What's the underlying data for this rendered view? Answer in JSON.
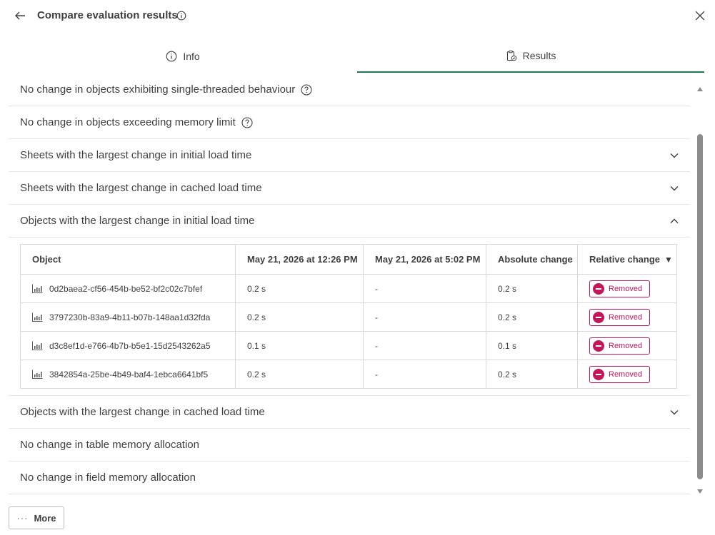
{
  "header": {
    "title": "Compare evaluation results"
  },
  "tabs": [
    {
      "label": "Info",
      "active": false
    },
    {
      "label": "Results",
      "active": true
    }
  ],
  "sections_top": [
    {
      "label": "No change in objects exhibiting single-threaded behaviour",
      "help": true
    },
    {
      "label": "No change in objects exceeding memory limit",
      "help": true
    },
    {
      "label": "Sheets with the largest change in initial load time",
      "expandable": true,
      "expanded": false
    },
    {
      "label": "Sheets with the largest change in cached load time",
      "expandable": true,
      "expanded": false
    },
    {
      "label": "Objects with the largest change in initial load time",
      "expandable": true,
      "expanded": true
    }
  ],
  "table": {
    "columns": [
      "Object",
      "May 21, 2026 at 12:26 PM",
      "May 21, 2026 at 5:02 PM",
      "Absolute change",
      "Relative change"
    ],
    "sort_column": "Relative change",
    "rows": [
      {
        "object": "0d2baea2-cf56-454b-be52-bf2c02c7bfef",
        "first": "0.2 s",
        "second": "-",
        "absolute": "0.2 s",
        "relative": "Removed"
      },
      {
        "object": "3797230b-83a9-4b11-b07b-148aa1d32fda",
        "first": "0.2 s",
        "second": "-",
        "absolute": "0.2 s",
        "relative": "Removed"
      },
      {
        "object": "d3c8ef1d-e766-4b7b-b5e1-15d2543262a5",
        "first": "0.1 s",
        "second": "-",
        "absolute": "0.1 s",
        "relative": "Removed"
      },
      {
        "object": "3842854a-25be-4b49-baf4-1ebca6641bf5",
        "first": "0.2 s",
        "second": "-",
        "absolute": "0.2 s",
        "relative": "Removed"
      }
    ]
  },
  "sections_bottom": [
    {
      "label": "Objects with the largest change in cached load time",
      "expandable": true,
      "expanded": false
    },
    {
      "label": "No change in table memory allocation"
    },
    {
      "label": "No change in field memory allocation"
    }
  ],
  "footer": {
    "more_dots": "···",
    "more_label": "More"
  },
  "colors": {
    "accent": "#1f7a4d",
    "removed": "#c2185b"
  },
  "icons": {
    "back": "arrow-left-icon",
    "info": "info-icon",
    "close": "close-icon",
    "results": "clipboard-check-icon",
    "help": "help-circle-icon",
    "chevron_down": "chevron-down-icon",
    "chevron_up": "chevron-up-icon",
    "object": "bar-chart-icon"
  }
}
